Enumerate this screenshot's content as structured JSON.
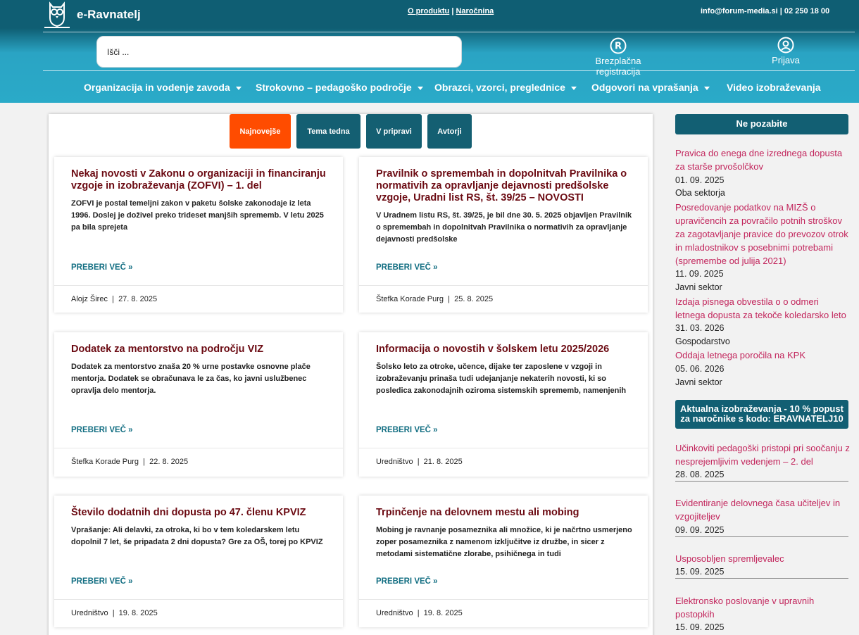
{
  "header": {
    "logo_text": "e-Ravnatelj",
    "links": {
      "about": "O produktu",
      "separator": "|",
      "subscription": "Naročnina"
    },
    "contact": "info@forum-media.si | 02 250 18 00",
    "search_placeholder": "Išči ...",
    "register_label": "Brezplačna registracija",
    "login_label": "Prijava"
  },
  "nav": [
    {
      "label": "Organizacija in vodenje zavoda",
      "dropdown": true
    },
    {
      "label": "Strokovno – pedagoško področje",
      "dropdown": true
    },
    {
      "label": "Obrazci, vzorci, preglednice",
      "dropdown": true
    },
    {
      "label": "Odgovori na vprašanja",
      "dropdown": true
    },
    {
      "label": "Video izobraževanja",
      "dropdown": false
    }
  ],
  "tabs": [
    {
      "label": "Najnovejše",
      "active": true
    },
    {
      "label": "Tema tedna",
      "active": false
    },
    {
      "label": "V pripravi",
      "active": false
    },
    {
      "label": "Avtorji",
      "active": false
    }
  ],
  "read_more": "PREBERI VEČ »",
  "articles": [
    {
      "title": "Nekaj novosti v Zakonu o organizaciji in financiranju vzgoje in izobraževanja (ZOFVI) – 1. del",
      "excerpt": "ZOFVI je postal temeljni zakon v paketu šolske zakonodaje iz leta 1996. Doslej je doživel preko trideset manjših sprememb. V letu 2025 pa bila sprejeta",
      "author": "Alojz Širec",
      "date": "27. 8. 2025"
    },
    {
      "title": "Pravilnik o spremembah in dopolnitvah Pravilnika o normativih za opravljanje dejavnosti predšolske vzgoje, Uradni list RS, št. 39/25 – NOVOSTI",
      "excerpt": "V Uradnem listu RS, št. 39/25, je bil dne 30. 5. 2025 objavljen Pravilnik o spremembah in dopolnitvah Pravilnika o normativih za opravljanje dejavnosti predšolske",
      "author": "Štefka Korade Purg",
      "date": "25. 8. 2025"
    },
    {
      "title": "Dodatek za mentorstvo na področju VIZ",
      "excerpt": "Dodatek za mentorstvo znaša 20 % urne postavke osnovne plače mentorja. Dodatek se obračunava le za čas, ko javni uslužbenec opravlja delo mentorja.",
      "author": "Štefka Korade Purg",
      "date": "22. 8. 2025"
    },
    {
      "title": "Informacija o novostih v šolskem letu 2025/2026",
      "excerpt": "Šolsko leto za otroke, učence, dijake ter zaposlene v vzgoji in izobraževanju prinaša tudi udejanjanje nekaterih novosti, ki so posledica zakonodajnih oziroma sistemskih sprememb, namenjenih",
      "author": "Uredništvo",
      "date": "21. 8. 2025"
    },
    {
      "title": "Število dodatnih dni dopusta po 47. členu KPVIZ",
      "excerpt": "Vprašanje: Ali delavki, za otroka, ki bo v tem koledarskem letu dopolnil 7 let, še pripadata 2 dni dopusta? Gre za OŠ, torej po KPVIZ",
      "author": "Uredništvo",
      "date": "19. 8. 2025"
    },
    {
      "title": "Trpinčenje na delovnem mestu ali mobing",
      "excerpt": "Mobing je ravnanje posameznika ali množice, ki je načrtno usmerjeno zoper posameznika z namenom izključitve iz družbe, in sicer z metodami sistematične zlorabe, psihičnega in tudi",
      "author": "Uredništvo",
      "date": "19. 8. 2025"
    }
  ],
  "sidebar": {
    "heading": "Ne pozabite",
    "reminders": [
      {
        "title": "Pravica do enega dne izrednega dopusta za starše prvošolčkov",
        "date": "01. 09. 2025",
        "sector": "Oba sektorja"
      },
      {
        "title": "Posredovanje podatkov na MIZŠ o upravičencih za povračilo potnih stroškov za zagotavljanje pravice do prevozov otrok in mladostnikov s posebnimi potrebami (spremembe od julija 2021)",
        "date": "11. 09. 2025",
        "sector": "Javni sektor"
      },
      {
        "title": "Izdaja pisnega obvestila o o odmeri letnega dopusta za tekoče koledarsko leto",
        "date": "31. 03. 2026",
        "sector": "Gospodarstvo"
      },
      {
        "title": "Oddaja letnega poročila na KPK",
        "date": "05. 06. 2026",
        "sector": "Javni sektor"
      }
    ],
    "banner": "Aktualna izobraževanja - 10 % popust za naročnike s kodo: ERAVNATELJ10",
    "events": [
      {
        "title": "Učinkoviti pedagoški pristopi pri soočanju z nesprejemljivim vedenjem – 2. del",
        "date": "28. 08. 2025"
      },
      {
        "title": "Evidentiranje delovnega časa učiteljev in vzgojiteljev",
        "date": "09. 09. 2025"
      },
      {
        "title": "Usposobljen spremljevalec",
        "date": "15. 09. 2025"
      },
      {
        "title": "Elektronsko poslovanje v upravnih postopkih",
        "date": "15. 09. 2025"
      }
    ]
  },
  "colors": {
    "header_dark": "#0f5e73",
    "header_light": "#2aaac8",
    "accent_orange": "#ff4c00",
    "title_red": "#6b0a12",
    "link_pink": "#c2255c",
    "teal": "#126e82"
  }
}
